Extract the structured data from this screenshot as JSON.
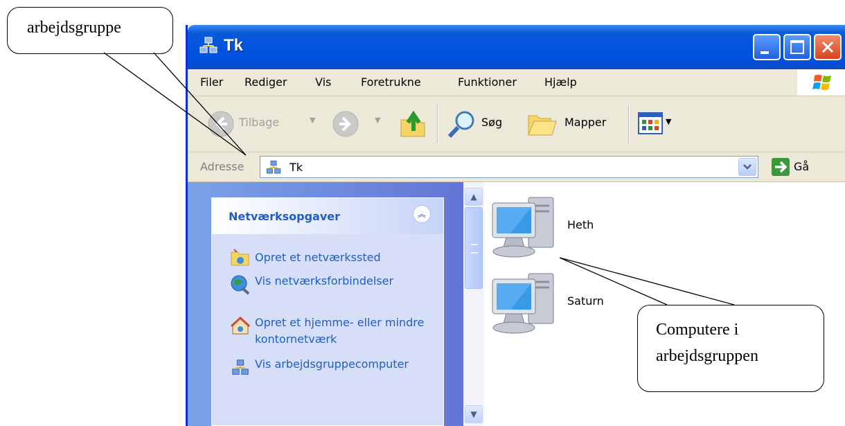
{
  "window": {
    "title": "Tk",
    "colors": {
      "titlebar": "#0354e0",
      "left_pane": "#6f8fe0",
      "task_link": "#215dc6"
    }
  },
  "menubar": {
    "items": [
      "Filer",
      "Rediger",
      "Vis",
      "Foretrukne",
      "Funktioner",
      "Hjælp"
    ]
  },
  "toolbar": {
    "back_label": "Tilbage",
    "search_label": "Søg",
    "folders_label": "Mapper"
  },
  "address": {
    "label": "Adresse",
    "value": "Tk",
    "go_label": "Gå"
  },
  "tasks": {
    "title": "Netværksopgaver",
    "items": [
      {
        "label": "Opret et netværkssted",
        "icon": "network-place-icon"
      },
      {
        "label": "Vis netværksforbindelser",
        "icon": "network-connections-icon"
      },
      {
        "label": "Opret et hjemme- eller mindre kontornetværk",
        "icon": "home-network-icon"
      },
      {
        "label": "Vis arbejdsgruppecomputer",
        "icon": "workgroup-icon"
      }
    ]
  },
  "computers": [
    {
      "name": "Heth"
    },
    {
      "name": "Saturn"
    }
  ],
  "callouts": {
    "workgroup": "arbejdsgruppe",
    "computers": "Computere i arbejdsgruppen"
  }
}
